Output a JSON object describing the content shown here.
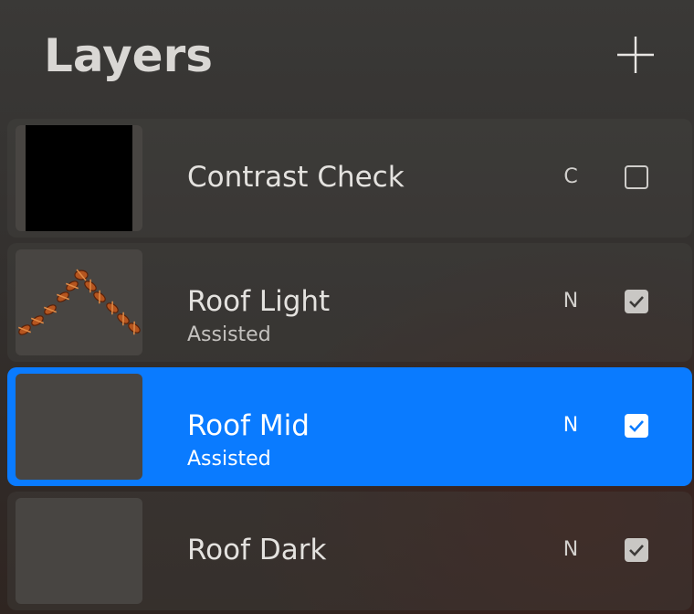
{
  "panel": {
    "title": "Layers",
    "add_icon": "plus-icon"
  },
  "colors": {
    "selected_row": "#0a7bff",
    "row_bg": "#3f3c3a",
    "text": "#e4e2df"
  },
  "layers": [
    {
      "name": "Contrast Check",
      "subtitle": "",
      "blend_mode": "C",
      "visible": false,
      "selected": false,
      "thumbnail": "black-fill"
    },
    {
      "name": "Roof Light",
      "subtitle": "Assisted",
      "blend_mode": "N",
      "visible": true,
      "selected": false,
      "thumbnail": "roof-beads"
    },
    {
      "name": "Roof Mid",
      "subtitle": "Assisted",
      "blend_mode": "N",
      "visible": true,
      "selected": true,
      "thumbnail": "empty"
    },
    {
      "name": "Roof Dark",
      "subtitle": "",
      "blend_mode": "N",
      "visible": true,
      "selected": false,
      "thumbnail": "empty"
    }
  ]
}
